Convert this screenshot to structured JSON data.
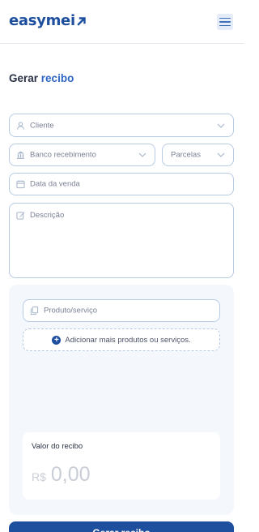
{
  "header": {
    "logo_text": "easymei",
    "brand_color": "#1e4f9e",
    "logo_icon": "arrow-up-right-icon",
    "menu_icon": "hamburger-menu-icon"
  },
  "page": {
    "title_prefix": "Gerar",
    "title_accent": "recibo",
    "accent_color": "#2f66c2"
  },
  "form": {
    "cliente": {
      "placeholder": "Cliente",
      "icon": "user-icon"
    },
    "banco": {
      "placeholder": "Banco recebimento",
      "icon": "bank-icon"
    },
    "parcelas": {
      "placeholder": "Parcelas"
    },
    "data_venda": {
      "placeholder": "Data da venda",
      "icon": "calendar-icon"
    },
    "descricao": {
      "placeholder": "Descrição",
      "icon": "edit-icon"
    }
  },
  "produtos": {
    "produto": {
      "placeholder": "Produto/serviço",
      "icon": "copy-icon"
    },
    "add_more_label": "Adicionar mais produtos ou serviços.",
    "add_icon": "plus-circle-icon"
  },
  "valor": {
    "label": "Valor do recibo",
    "currency": "R$",
    "amount": "0,00"
  },
  "submit": {
    "label": "Gerar recibo"
  }
}
